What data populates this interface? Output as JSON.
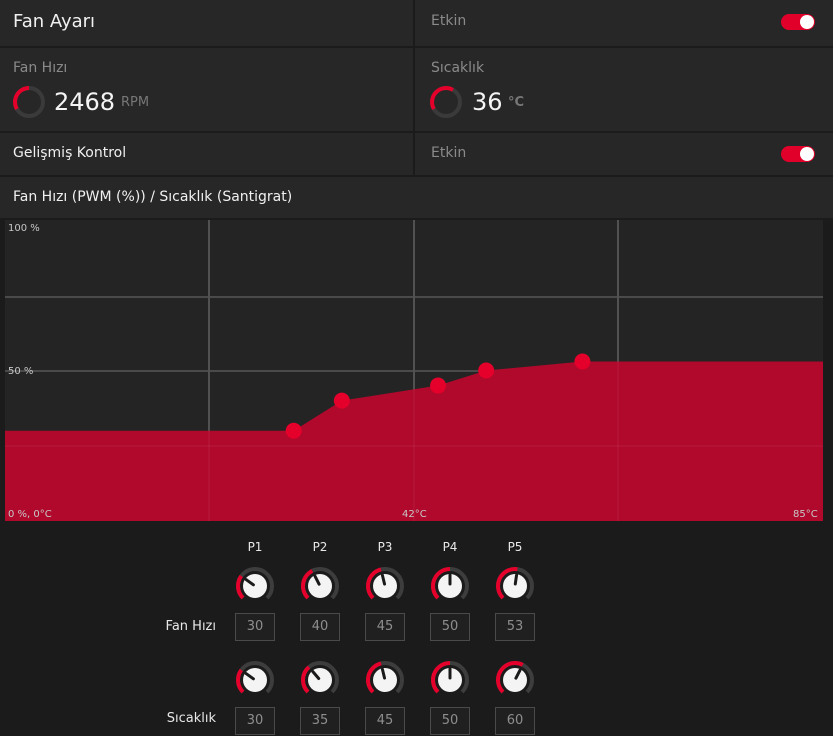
{
  "fan_settings": {
    "title": "Fan Ayarı",
    "enabled_label": "Etkin",
    "enabled": true
  },
  "fan_speed": {
    "label": "Fan Hızı",
    "value": "2468",
    "unit": "RPM"
  },
  "temperature": {
    "label": "Sıcaklık",
    "value": "36",
    "unit": "°C"
  },
  "advanced": {
    "title": "Gelişmiş Kontrol",
    "enabled_label": "Etkin",
    "enabled": true
  },
  "curve_header": "Fan Hızı (PWM (%)) / Sıcaklık (Santigrat)",
  "chart_data": {
    "type": "area",
    "x_range": [
      0,
      85
    ],
    "y_range": [
      0,
      100
    ],
    "x_labels": {
      "min": "0 %, 0°C",
      "mid": "42°C",
      "max": "85°C"
    },
    "y_labels": {
      "top": "100 %",
      "mid": "50 %"
    },
    "points": [
      {
        "x": 30,
        "y": 30
      },
      {
        "x": 35,
        "y": 40
      },
      {
        "x": 45,
        "y": 45
      },
      {
        "x": 50,
        "y": 50
      },
      {
        "x": 60,
        "y": 53
      }
    ],
    "fill_color": "#b0092c",
    "point_color": "#e4002b",
    "grid": true
  },
  "controls": {
    "point_labels": [
      "P1",
      "P2",
      "P3",
      "P4",
      "P5"
    ],
    "fan_row_label": "Fan Hızı",
    "temp_row_label": "Sıcaklık",
    "fan_values": [
      "30",
      "40",
      "45",
      "50",
      "53"
    ],
    "temp_values": [
      "30",
      "35",
      "45",
      "50",
      "60"
    ],
    "fan_levels": [
      30,
      40,
      45,
      50,
      53
    ],
    "temp_levels": [
      30,
      35,
      45,
      50,
      60
    ]
  },
  "colors": {
    "accent": "#e4002b",
    "panel": "#272727",
    "background": "#1b1b1b"
  }
}
